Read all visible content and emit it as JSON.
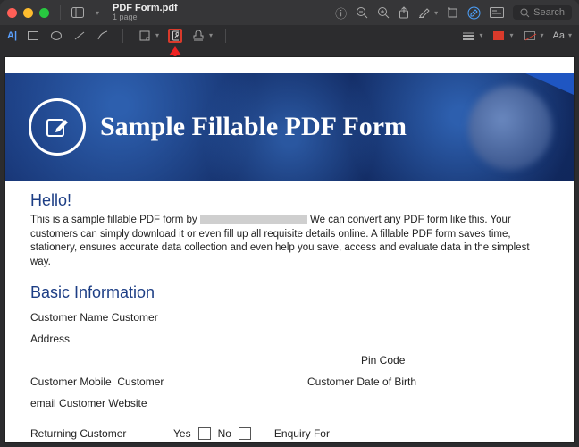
{
  "window": {
    "title": "PDF Form.pdf",
    "subtitle": "1 page",
    "search_placeholder": "Search"
  },
  "toolstrip": {
    "text_tool": "A|",
    "font_label": "Aa"
  },
  "document": {
    "banner_title": "Sample Fillable PDF Form",
    "hello": "Hello!",
    "intro_pre": "This is a sample fillable PDF form by ",
    "intro_post": " We can convert any PDF form like this. Your customers can simply download it or even fill up all requisite details online. A fillable PDF form saves time, stationery, ensures accurate data collection and even help you save, access and evaluate data in the simplest way.",
    "section_basic": "Basic Information",
    "labels": {
      "name": "Customer Name",
      "customer": "Customer",
      "address": "Address",
      "pincode": "Pin Code",
      "mobile": "Customer Mobile",
      "dob": "Customer Date of Birth",
      "email": "email",
      "website": "Customer Website",
      "returning": "Returning Customer",
      "yes": "Yes",
      "no": "No",
      "enquiry": "Enquiry For"
    }
  }
}
